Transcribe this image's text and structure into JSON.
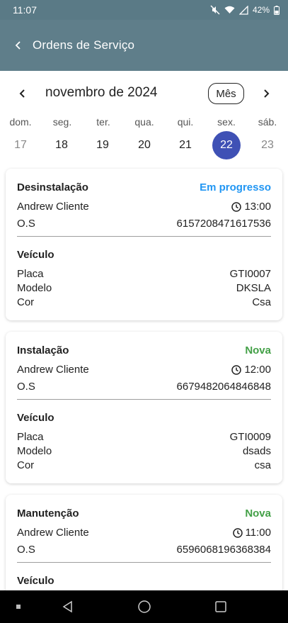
{
  "status_bar": {
    "time": "11:07",
    "battery": "42%"
  },
  "app_bar": {
    "title": "Ordens de Serviço"
  },
  "calendar": {
    "month_label": "novembro de 2024",
    "view_button": "Mês",
    "weekdays": [
      "dom.",
      "seg.",
      "ter.",
      "qua.",
      "qui.",
      "sex.",
      "sáb."
    ],
    "days": [
      "17",
      "18",
      "19",
      "20",
      "21",
      "22",
      "23"
    ],
    "selected_day": "22"
  },
  "orders": [
    {
      "type": "Desinstalação",
      "status": "Em progresso",
      "client": "Andrew Cliente",
      "time": "13:00",
      "os_label": "O.S",
      "os_number": "6157208471617536",
      "vehicle_title": "Veículo",
      "placa_label": "Placa",
      "placa": "GTI0007",
      "modelo_label": "Modelo",
      "modelo": "DKSLA",
      "cor_label": "Cor",
      "cor": "Csa"
    },
    {
      "type": "Instalação",
      "status": "Nova",
      "client": "Andrew Cliente",
      "time": "12:00",
      "os_label": "O.S",
      "os_number": "6679482064846848",
      "vehicle_title": "Veículo",
      "placa_label": "Placa",
      "placa": "GTI0009",
      "modelo_label": "Modelo",
      "modelo": "dsads",
      "cor_label": "Cor",
      "cor": "csa"
    },
    {
      "type": "Manutenção",
      "status": "Nova",
      "client": "Andrew Cliente",
      "time": "11:00",
      "os_label": "O.S",
      "os_number": "6596068196368384",
      "vehicle_title": "Veículo"
    }
  ],
  "colors": {
    "app_bar": "#5f7e8a",
    "selected_day": "#3f51b5",
    "status_in_progress": "#2196f3",
    "status_new": "#43a047"
  }
}
